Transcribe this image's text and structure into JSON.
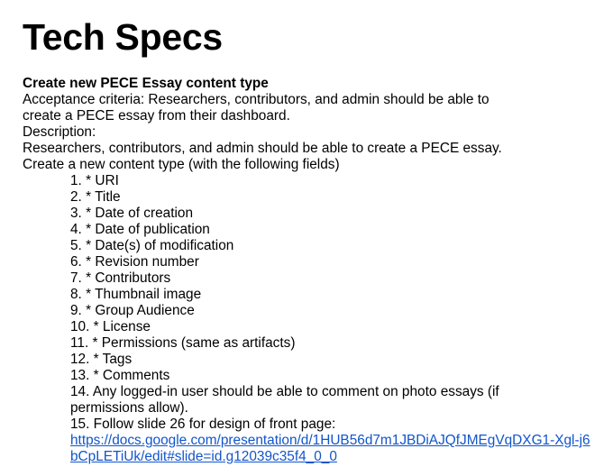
{
  "document": {
    "title": "Tech Specs",
    "section_heading": "Create new PECE Essay content type",
    "acceptance_line1": "Acceptance criteria: Researchers, contributors, and admin should be able to",
    "acceptance_line2": "create a PECE essay from their dashboard.",
    "description_label": "Description:",
    "description_text": "Researchers, contributors, and admin should be able to create a PECE essay.",
    "content_type_intro": "Create a new content type (with the following fields)",
    "fields": [
      "1. * URI",
      "2. * Title",
      "3. * Date of creation",
      "4. * Date of publication",
      "5. * Date(s) of modification",
      "6. * Revision number",
      "7. * Contributors",
      "8. * Thumbnail image",
      "9. * Group Audience",
      "10. * License",
      "11. * Permissions (same as artifacts)",
      "12. * Tags",
      "13. * Comments"
    ],
    "item14": "14. Any logged-in user should be able to comment on photo essays (if permissions allow).",
    "item15": "15. Follow slide 26 for design of front page:",
    "link_text": "https://docs.google.com/presentation/d/1HUB56d7m1JBDiAJQfJMEgVqDXG1-Xgl-j6bCpLETiUk/edit#slide=id.g12039c35f4_0_0",
    "link_color": "#1155cc"
  }
}
